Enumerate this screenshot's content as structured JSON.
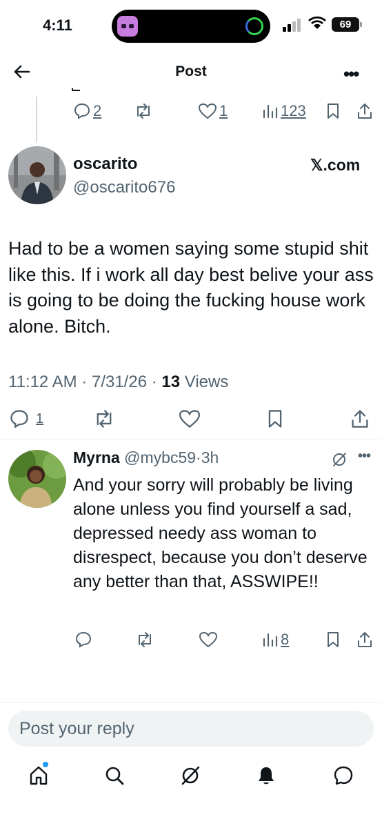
{
  "status_bar": {
    "time": "4:11",
    "battery": "69"
  },
  "nav": {
    "title": "Post"
  },
  "parent_post": {
    "actions": {
      "replies": "2",
      "likes": "1",
      "views": "123"
    }
  },
  "post": {
    "author": {
      "name": "oscarito",
      "handle": "@oscarito676"
    },
    "source": "𝕏.com",
    "text": "Had to be a women saying some stupid shit like this. If i work all day best belive your ass is going to be doing the fucking house work alone. Bitch.",
    "time": "11:12 AM",
    "date": "7/31/26",
    "views_count": "13",
    "views_label": "Views",
    "meta_sep": "·",
    "actions": {
      "replies": "1"
    }
  },
  "reply": {
    "author": {
      "name": "Myrna",
      "handle": "@mybc59",
      "sep": "·",
      "age": "3h"
    },
    "text": "And your sorry will probably be living alone unless you find yourself a sad, depressed needy ass woman to disrespect, because you don’t deserve any better than that, ASSWIPE!!",
    "actions": {
      "views": "8"
    }
  },
  "composer": {
    "placeholder": "Post your reply"
  },
  "tabs": [
    {
      "name": "home",
      "icon": "home-icon"
    },
    {
      "name": "search",
      "icon": "search-icon"
    },
    {
      "name": "grok",
      "icon": "grok-icon"
    },
    {
      "name": "notifications",
      "icon": "bell-icon"
    },
    {
      "name": "messages",
      "icon": "message-icon"
    }
  ],
  "colors": {
    "text": "#0f1419",
    "secondary": "#536471",
    "accent": "#1d9bf0",
    "divider": "#eff3f4"
  }
}
